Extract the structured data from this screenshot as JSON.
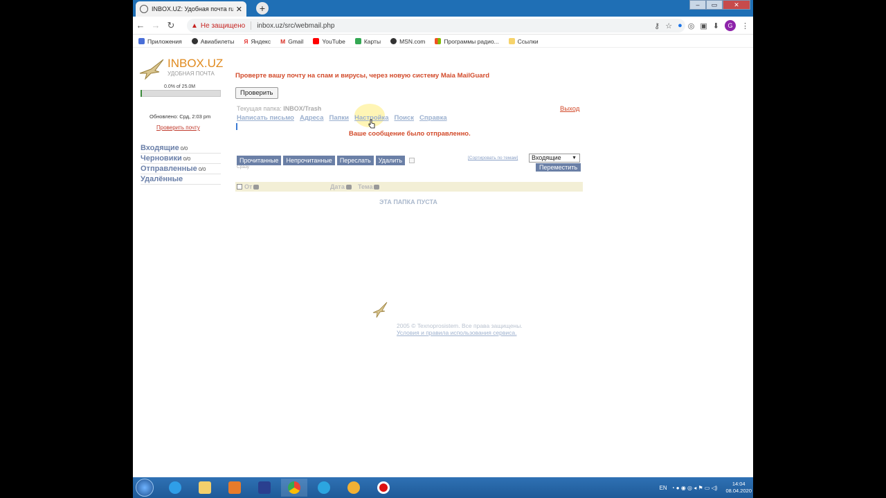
{
  "browser": {
    "tab_title": "INBOX.UZ: Удобная почта rusta",
    "tab_close": "✕",
    "new_tab": "+",
    "back": "←",
    "forward": "→",
    "reload": "↻",
    "security_warning": "Не защищено",
    "url": "inbox.uz/src/webmail.php",
    "profile_initial": "G",
    "bookmarks": [
      {
        "label": "Приложения",
        "color": "#4a6fd8"
      },
      {
        "label": "Авиабилеты",
        "color": "#333333"
      },
      {
        "label": "Яндекс",
        "color": "#e53935"
      },
      {
        "label": "Gmail",
        "color": "#d93025"
      },
      {
        "label": "YouTube",
        "color": "#ff0000"
      },
      {
        "label": "Карты",
        "color": "#34a853"
      },
      {
        "label": "MSN.com",
        "color": "#333333"
      },
      {
        "label": "Программы радио...",
        "color": "#f4b400"
      },
      {
        "label": "Ссылки",
        "color": "#f6d36b"
      }
    ]
  },
  "sidebar": {
    "logo_name": "INBOX.UZ",
    "logo_sub": "УДОБНАЯ ПОЧТА",
    "quota_text": "0.0% of 25.0M",
    "quota_fraction": 0.0,
    "updated": "Обновлено: Срд, 2:03 pm",
    "check_mail_link": "Проверить почту",
    "folders": [
      {
        "name": "Входящие",
        "count": "0/0"
      },
      {
        "name": "Черновики",
        "count": "0/0"
      },
      {
        "name": "Отправленные",
        "count": "0/0"
      },
      {
        "name": "Удалённые",
        "count": ""
      }
    ]
  },
  "main": {
    "promo": "Проверте вашу почту на спам и вирусы, через новую систему Maia MailGuard",
    "check_button": "Проверить",
    "current_folder_label": "Текущая папка:",
    "current_folder": "INBOX/Trash",
    "logout": "Выход",
    "menu": [
      "Написать письмо",
      "Адреса",
      "Папки",
      "Настройка",
      "Поиск",
      "Справка"
    ],
    "sent_message": "Ваше сообщение было отправленно.",
    "actions": [
      "Прочитанные",
      "Непрочитанные",
      "Переслать",
      "Удалить"
    ],
    "immediate": "Сразу",
    "sort_link": "[Сортировать по темам]",
    "move_select": "Входящие",
    "move_button": "Переместить",
    "columns": [
      "От",
      "Дата",
      "Тема"
    ],
    "empty_folder": "ЭТА ПАПКА ПУСТА",
    "footer_copyright": "2005 © Texnoprosistem. Все права защищены.",
    "footer_terms": "Условия и правила использования сервиса."
  },
  "taskbar": {
    "language": "EN",
    "time": "14:04",
    "date": "08.04.2020"
  }
}
